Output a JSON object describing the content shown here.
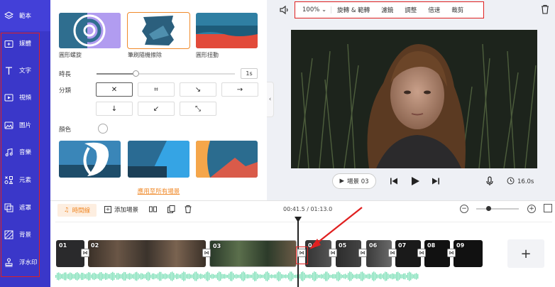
{
  "nav": {
    "items": [
      {
        "label": "範本",
        "icon": "layers-icon"
      },
      {
        "label": "媒體",
        "icon": "media-folder-icon"
      },
      {
        "label": "文字",
        "icon": "text-icon"
      },
      {
        "label": "視頻",
        "icon": "video-icon"
      },
      {
        "label": "圖片",
        "icon": "image-icon"
      },
      {
        "label": "音樂",
        "icon": "music-icon"
      },
      {
        "label": "元素",
        "icon": "elements-icon"
      },
      {
        "label": "遮罩",
        "icon": "overlay-icon"
      },
      {
        "label": "背景",
        "icon": "background-icon"
      },
      {
        "label": "浮水印",
        "icon": "watermark-icon"
      }
    ]
  },
  "panel": {
    "transitions": [
      {
        "label": "圓形螺旋"
      },
      {
        "label": "筆刷隨機擦除"
      },
      {
        "label": "圓形扭動"
      }
    ],
    "duration_label": "時長",
    "duration_value": "1s",
    "duration_fraction": 0.28,
    "direction_label": "分類",
    "directions": [
      "✕",
      "⌗",
      "↘",
      "→",
      "↓",
      "↙",
      "⤡"
    ],
    "color_label": "顏色",
    "apply_all": "應用至所有場景"
  },
  "toolbar": {
    "zoom": "100%",
    "items": [
      "旋轉 & 範轉",
      "濾鏡",
      "調整",
      "倍速",
      "裁剪"
    ]
  },
  "player": {
    "scene_button": "場景 03",
    "duration": "16.0s"
  },
  "timeline": {
    "tab": "時間線",
    "add_scene": "添加場景",
    "time": "00:41.5 / 01:13.0",
    "clips": [
      "01",
      "02",
      "03",
      "04",
      "05",
      "06",
      "07",
      "08",
      "09"
    ],
    "zoom_fraction": 0.28
  },
  "colors": {
    "nav_bg": "#3a37c9",
    "accent": "#f08a2a",
    "highlight": "#e02020",
    "audio": "#7ee0b8"
  }
}
